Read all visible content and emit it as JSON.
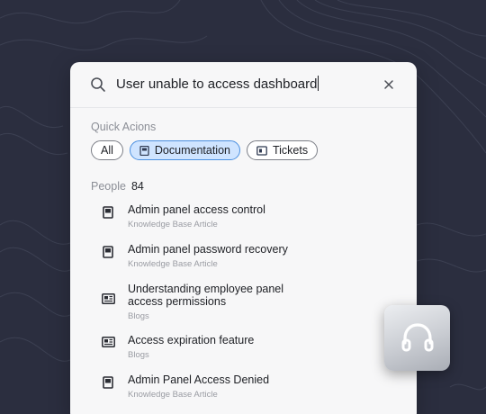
{
  "search": {
    "query": "User unable to access dashboard"
  },
  "quick_actions": {
    "label": "Quick Acions",
    "chips": [
      {
        "label": "All",
        "active": false
      },
      {
        "label": "Documentation",
        "active": true,
        "icon": "book-icon"
      },
      {
        "label": "Tickets",
        "active": false,
        "icon": "ticket-icon"
      }
    ]
  },
  "people": {
    "label": "People",
    "count": "84"
  },
  "results": [
    {
      "title": "Admin panel access control",
      "subtitle": "Knowledge Base Article",
      "icon": "book-icon"
    },
    {
      "title": "Admin panel password recovery",
      "subtitle": "Knowledge Base Article",
      "icon": "book-icon"
    },
    {
      "title": "Understanding employee panel access permissions",
      "subtitle": "Blogs",
      "icon": "newspaper-icon"
    },
    {
      "title": "Access expiration feature",
      "subtitle": "Blogs",
      "icon": "newspaper-icon"
    },
    {
      "title": "Admin Panel Access Denied",
      "subtitle": "Knowledge Base Article",
      "icon": "book-icon"
    }
  ],
  "colors": {
    "background": "#2b2e3f",
    "panel": "#f7f7f8",
    "active_chip": "#cfe4ff",
    "active_chip_border": "#4a8fe0"
  }
}
